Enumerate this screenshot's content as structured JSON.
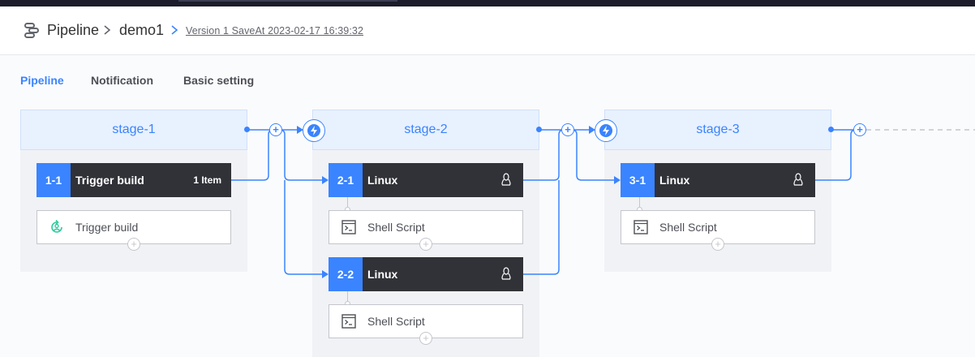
{
  "header": {
    "breadcrumb": [
      "Pipeline",
      "demo1"
    ],
    "version_label": "Version 1 SaveAt 2023-02-17 16:39:32"
  },
  "tabs": [
    "Pipeline",
    "Notification",
    "Basic setting"
  ],
  "active_tab": "Pipeline",
  "stages": [
    {
      "name": "stage-1",
      "jobs": [
        {
          "id": "1-1",
          "name": "Trigger build",
          "badge": "1 Item",
          "steps": [
            {
              "label": "Trigger build",
              "icon": "trigger-icon"
            }
          ]
        }
      ]
    },
    {
      "name": "stage-2",
      "jobs": [
        {
          "id": "2-1",
          "name": "Linux",
          "os_icon": "linux-icon",
          "steps": [
            {
              "label": "Shell Script",
              "icon": "terminal-icon"
            }
          ]
        },
        {
          "id": "2-2",
          "name": "Linux",
          "os_icon": "linux-icon",
          "steps": [
            {
              "label": "Shell Script",
              "icon": "terminal-icon"
            }
          ]
        }
      ]
    },
    {
      "name": "stage-3",
      "jobs": [
        {
          "id": "3-1",
          "name": "Linux",
          "os_icon": "linux-icon",
          "steps": [
            {
              "label": "Shell Script",
              "icon": "terminal-icon"
            }
          ]
        }
      ]
    }
  ],
  "colors": {
    "accent": "#3a84ff",
    "job_bg": "#313238",
    "stage_head_bg": "#e8f1fe",
    "stage_bg": "#f1f2f5"
  }
}
